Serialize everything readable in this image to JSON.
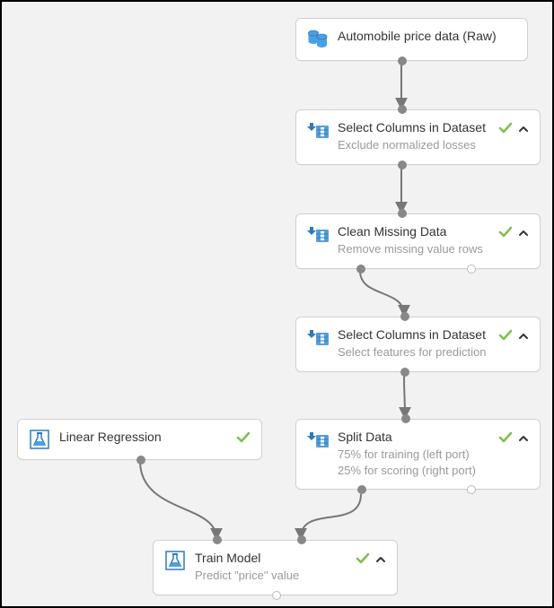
{
  "nodes": {
    "data_source": {
      "title": "Automobile price data (Raw)"
    },
    "select1": {
      "title": "Select Columns in Dataset",
      "subtitle": "Exclude normalized losses"
    },
    "clean": {
      "title": "Clean Missing Data",
      "subtitle": "Remove missing value rows"
    },
    "select2": {
      "title": "Select Columns in Dataset",
      "subtitle": "Select features for prediction"
    },
    "linreg": {
      "title": "Linear Regression"
    },
    "split": {
      "title": "Split Data",
      "subtitle": "75% for training (left port)\n25% for scoring (right port)"
    },
    "train": {
      "title": "Train Model",
      "subtitle": "Predict \"price\" value"
    }
  }
}
